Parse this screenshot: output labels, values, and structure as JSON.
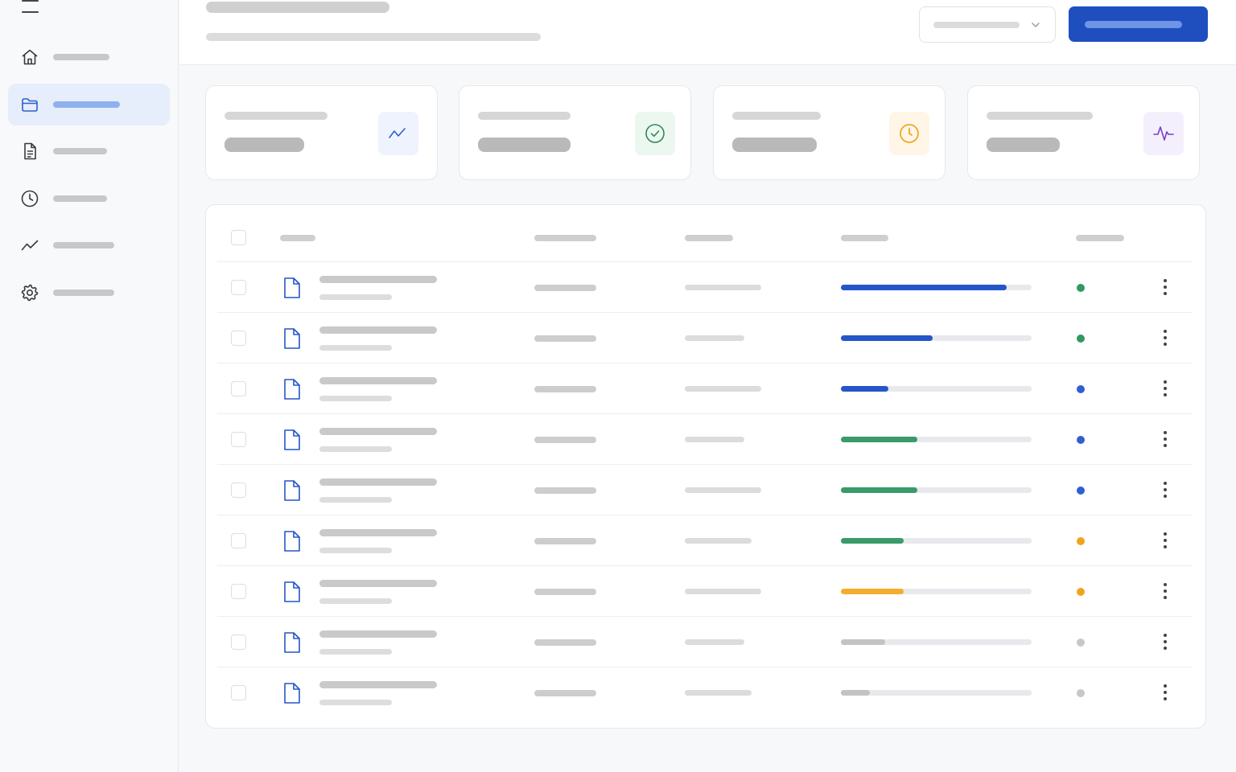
{
  "sidebar": {
    "menu_icon": "hamburger-icon",
    "items": [
      {
        "icon": "home-icon",
        "active": false
      },
      {
        "icon": "folder-icon",
        "active": true
      },
      {
        "icon": "document-icon",
        "active": false
      },
      {
        "icon": "clock-icon",
        "active": false
      },
      {
        "icon": "trend-icon",
        "active": false
      },
      {
        "icon": "gear-icon",
        "active": false
      }
    ]
  },
  "header": {
    "dropdown_icon": "chevron-down-icon"
  },
  "stats": [
    {
      "icon": "trend-line-icon",
      "accent": "#2f5fd0",
      "tint": "#eef3fd"
    },
    {
      "icon": "check-circle-icon",
      "accent": "#2e8a57",
      "tint": "#ecf7f0"
    },
    {
      "icon": "clock-icon",
      "accent": "#f0a41c",
      "tint": "#fff6e8"
    },
    {
      "icon": "pulse-icon",
      "accent": "#7b3fc6",
      "tint": "#f4effc"
    }
  ],
  "table": {
    "rows": [
      {
        "progress": 0.87,
        "color": "#2456c8",
        "status": "#2e9a5e"
      },
      {
        "progress": 0.48,
        "color": "#2456c8",
        "status": "#2e9a5e"
      },
      {
        "progress": 0.25,
        "color": "#2456c8",
        "status": "#2f5fd0"
      },
      {
        "progress": 0.4,
        "color": "#3a9a6a",
        "status": "#2f5fd0"
      },
      {
        "progress": 0.4,
        "color": "#3a9a6a",
        "status": "#2f5fd0"
      },
      {
        "progress": 0.33,
        "color": "#3a9a6a",
        "status": "#f0a41c"
      },
      {
        "progress": 0.33,
        "color": "#f4ad2f",
        "status": "#f0a41c"
      },
      {
        "progress": 0.23,
        "color": "#c3c3c3",
        "status": "#c8c8c8"
      },
      {
        "progress": 0.15,
        "color": "#c3c3c3",
        "status": "#c8c8c8"
      }
    ]
  },
  "colors": {
    "brand": "#1f4fbf",
    "active_nav_bg": "#e6edfb"
  }
}
